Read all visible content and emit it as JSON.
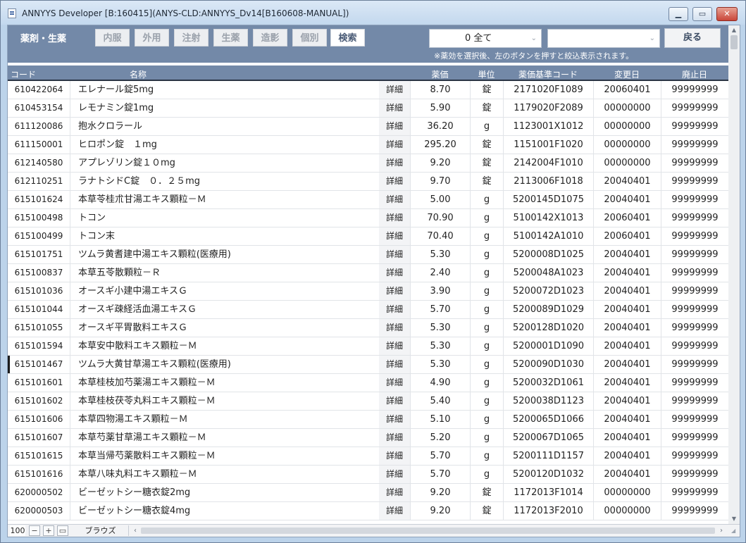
{
  "window": {
    "title": "ANNYYS Developer [B:160415](ANYS-CLD:ANNYYS_Dv14[B160608-MANUAL])",
    "min_label": "▁",
    "max_label": "▭",
    "close_label": "✕"
  },
  "toolbar": {
    "title": "薬剤・生薬",
    "tabs": [
      {
        "label": "内服"
      },
      {
        "label": "外用"
      },
      {
        "label": "注射"
      },
      {
        "label": "生薬"
      },
      {
        "label": "造影"
      },
      {
        "label": "個別"
      },
      {
        "label": "検索"
      }
    ],
    "filter_value": "0 全て",
    "filter2_value": "",
    "back_label": "戻る",
    "hint": "※薬効を選択後、左のボタンを押すと絞込表示されます。"
  },
  "table": {
    "headers": {
      "code": "コード",
      "name": "名称",
      "price": "薬価",
      "unit": "単位",
      "std_code": "薬価基準コード",
      "changed": "変更日",
      "abolished": "廃止日"
    },
    "detail_label": "詳細",
    "rows": [
      {
        "code": "610422064",
        "name": "エレナール錠5mg",
        "price": "8.70",
        "unit": "錠",
        "std_code": "2171020F1089",
        "changed": "20060401",
        "abolished": "99999999"
      },
      {
        "code": "610453154",
        "name": "レモナミン錠1mg",
        "price": "5.90",
        "unit": "錠",
        "std_code": "1179020F2089",
        "changed": "00000000",
        "abolished": "99999999"
      },
      {
        "code": "611120086",
        "name": "抱水クロラール",
        "price": "36.20",
        "unit": "g",
        "std_code": "1123001X1012",
        "changed": "00000000",
        "abolished": "99999999"
      },
      {
        "code": "611150001",
        "name": "ヒロポン錠　１mg",
        "price": "295.20",
        "unit": "錠",
        "std_code": "1151001F1020",
        "changed": "00000000",
        "abolished": "99999999"
      },
      {
        "code": "612140580",
        "name": "アプレゾリン錠１０mg",
        "price": "9.20",
        "unit": "錠",
        "std_code": "2142004F1010",
        "changed": "00000000",
        "abolished": "99999999"
      },
      {
        "code": "612110251",
        "name": "ラナトシドC錠　０．２５mg",
        "price": "9.70",
        "unit": "錠",
        "std_code": "2113006F1018",
        "changed": "20040401",
        "abolished": "99999999"
      },
      {
        "code": "615101624",
        "name": "本草苓桂朮甘湯エキス顆粒－Ｍ",
        "price": "5.00",
        "unit": "g",
        "std_code": "5200145D1075",
        "changed": "20040401",
        "abolished": "99999999"
      },
      {
        "code": "615100498",
        "name": "トコン",
        "price": "70.90",
        "unit": "g",
        "std_code": "5100142X1013",
        "changed": "20060401",
        "abolished": "99999999"
      },
      {
        "code": "615100499",
        "name": "トコン末",
        "price": "70.40",
        "unit": "g",
        "std_code": "5100142A1010",
        "changed": "20060401",
        "abolished": "99999999"
      },
      {
        "code": "615101751",
        "name": "ツムラ黄耆建中湯エキス顆粒(医療用)",
        "price": "5.30",
        "unit": "g",
        "std_code": "5200008D1025",
        "changed": "20040401",
        "abolished": "99999999"
      },
      {
        "code": "615100837",
        "name": "本草五苓散顆粒－Ｒ",
        "price": "2.40",
        "unit": "g",
        "std_code": "5200048A1023",
        "changed": "20040401",
        "abolished": "99999999"
      },
      {
        "code": "615101036",
        "name": "オースギ小建中湯エキスＧ",
        "price": "3.90",
        "unit": "g",
        "std_code": "5200072D1023",
        "changed": "20040401",
        "abolished": "99999999"
      },
      {
        "code": "615101044",
        "name": "オースギ疎経活血湯エキスＧ",
        "price": "5.70",
        "unit": "g",
        "std_code": "5200089D1029",
        "changed": "20040401",
        "abolished": "99999999"
      },
      {
        "code": "615101055",
        "name": "オースギ平胃散料エキスＧ",
        "price": "5.30",
        "unit": "g",
        "std_code": "5200128D1020",
        "changed": "20040401",
        "abolished": "99999999"
      },
      {
        "code": "615101594",
        "name": "本草安中散料エキス顆粒－Ｍ",
        "price": "5.30",
        "unit": "g",
        "std_code": "5200001D1090",
        "changed": "20040401",
        "abolished": "99999999"
      },
      {
        "code": "615101467",
        "name": "ツムラ大黄甘草湯エキス顆粒(医療用)",
        "price": "5.30",
        "unit": "g",
        "std_code": "5200090D1030",
        "changed": "20040401",
        "abolished": "99999999"
      },
      {
        "code": "615101601",
        "name": "本草桂枝加芍薬湯エキス顆粒－Ｍ",
        "price": "4.90",
        "unit": "g",
        "std_code": "5200032D1061",
        "changed": "20040401",
        "abolished": "99999999"
      },
      {
        "code": "615101602",
        "name": "本草桂枝茯苓丸料エキス顆粒－Ｍ",
        "price": "5.40",
        "unit": "g",
        "std_code": "5200038D1123",
        "changed": "20040401",
        "abolished": "99999999"
      },
      {
        "code": "615101606",
        "name": "本草四物湯エキス顆粒－Ｍ",
        "price": "5.10",
        "unit": "g",
        "std_code": "5200065D1066",
        "changed": "20040401",
        "abolished": "99999999"
      },
      {
        "code": "615101607",
        "name": "本草芍薬甘草湯エキス顆粒－Ｍ",
        "price": "5.20",
        "unit": "g",
        "std_code": "5200067D1065",
        "changed": "20040401",
        "abolished": "99999999"
      },
      {
        "code": "615101615",
        "name": "本草当帰芍薬散料エキス顆粒－Ｍ",
        "price": "5.70",
        "unit": "g",
        "std_code": "5200111D1157",
        "changed": "20040401",
        "abolished": "99999999"
      },
      {
        "code": "615101616",
        "name": "本草八味丸料エキス顆粒－Ｍ",
        "price": "5.70",
        "unit": "g",
        "std_code": "5200120D1032",
        "changed": "20040401",
        "abolished": "99999999"
      },
      {
        "code": "620000502",
        "name": "ビーゼットシー糖衣錠2mg",
        "price": "9.20",
        "unit": "錠",
        "std_code": "1172013F1014",
        "changed": "00000000",
        "abolished": "99999999"
      },
      {
        "code": "620000503",
        "name": "ビーゼットシー糖衣錠4mg",
        "price": "9.20",
        "unit": "錠",
        "std_code": "1172013F2010",
        "changed": "00000000",
        "abolished": "99999999"
      }
    ],
    "current_row_index": 15
  },
  "statusbar": {
    "count": "100",
    "minus_label": "−",
    "plus_label": "+",
    "form_label": "▭",
    "mode": "ブラウズ"
  },
  "colors": {
    "header_bg": "#7389a8",
    "titlebar_bg": "#c3d8ee",
    "close_button": "#c9463a"
  },
  "icons": {
    "scroll_up": "scroll-up-icon",
    "scroll_down": "scroll-down-icon",
    "scroll_left": "scroll-left-icon",
    "scroll_right": "scroll-right-icon",
    "combo_arrow": "chevron-down-icon",
    "app": "app-document-icon"
  }
}
